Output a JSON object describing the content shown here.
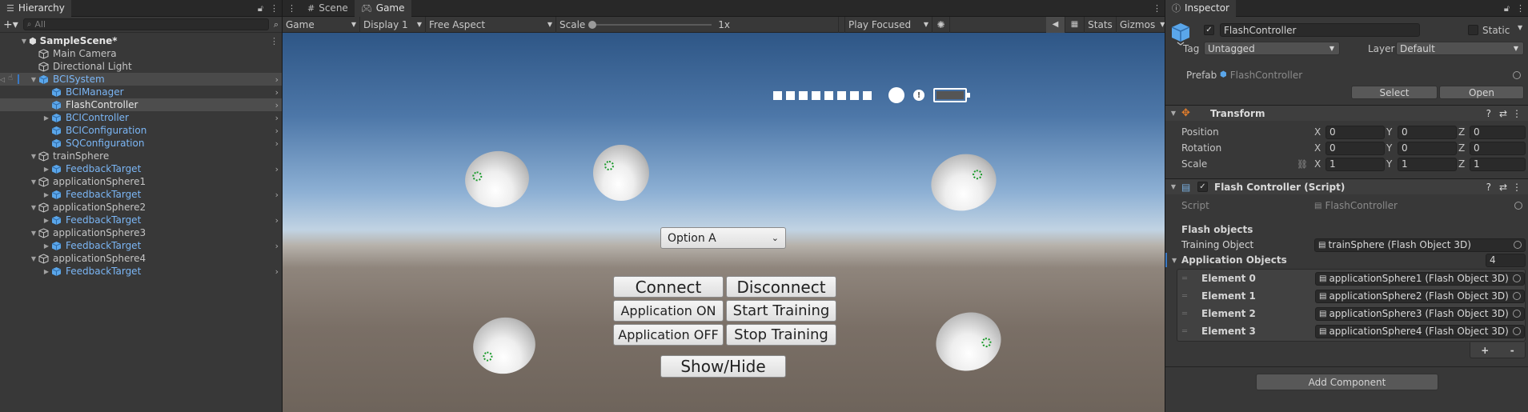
{
  "hierarchy": {
    "tab_label": "Hierarchy",
    "search_placeholder": "All",
    "scene_name": "SampleScene*",
    "items": [
      {
        "label": "Main Camera",
        "prefab": false
      },
      {
        "label": "Directional Light",
        "prefab": false
      },
      {
        "label": "BCISystem",
        "prefab": true
      },
      {
        "label": "BCIManager",
        "prefab": true
      },
      {
        "label": "FlashController",
        "prefab": true
      },
      {
        "label": "BCIController",
        "prefab": true
      },
      {
        "label": "BCIConfiguration",
        "prefab": true
      },
      {
        "label": "SQConfiguration",
        "prefab": true
      },
      {
        "label": "trainSphere",
        "prefab": false
      },
      {
        "label": "FeedbackTarget",
        "prefab": true
      },
      {
        "label": "applicationSphere1",
        "prefab": false
      },
      {
        "label": "FeedbackTarget",
        "prefab": true
      },
      {
        "label": "applicationSphere2",
        "prefab": false
      },
      {
        "label": "FeedbackTarget",
        "prefab": true
      },
      {
        "label": "applicationSphere3",
        "prefab": false
      },
      {
        "label": "FeedbackTarget",
        "prefab": true
      },
      {
        "label": "applicationSphere4",
        "prefab": false
      },
      {
        "label": "FeedbackTarget",
        "prefab": true
      }
    ]
  },
  "game": {
    "tabs": [
      {
        "label": "Scene"
      },
      {
        "label": "Game"
      }
    ],
    "toolbar": {
      "view_mode": "Game",
      "display": "Display 1",
      "aspect": "Free Aspect",
      "scale_label": "Scale",
      "scale_value": "1x",
      "play_mode": "Play Focused",
      "stats": "Stats",
      "gizmos": "Gizmos"
    },
    "ui": {
      "dropdown_value": "Option A",
      "connect": "Connect",
      "disconnect": "Disconnect",
      "app_on": "Application ON",
      "start_training": "Start Training",
      "app_off": "Application OFF",
      "stop_training": "Stop Training",
      "show_hide": "Show/Hide"
    }
  },
  "inspector": {
    "tab_label": "Inspector",
    "object_name": "FlashController",
    "static_label": "Static",
    "tag_label": "Tag",
    "tag_value": "Untagged",
    "layer_label": "Layer",
    "layer_value": "Default",
    "prefab_label": "Prefab",
    "prefab_value": "FlashController",
    "select_label": "Select",
    "open_label": "Open",
    "transform": {
      "title": "Transform",
      "position_label": "Position",
      "rotation_label": "Rotation",
      "scale_label": "Scale",
      "position": {
        "x": "0",
        "y": "0",
        "z": "0"
      },
      "rotation": {
        "x": "0",
        "y": "0",
        "z": "0"
      },
      "scale": {
        "x": "1",
        "y": "1",
        "z": "1"
      },
      "axis_x": "X",
      "axis_y": "Y",
      "axis_z": "Z"
    },
    "script_component": {
      "title": "Flash Controller (Script)",
      "script_label": "Script",
      "script_value": "FlashController",
      "section_label": "Flash objects",
      "training_label": "Training Object",
      "training_value": "trainSphere (Flash Object 3D)",
      "application_label": "Application Objects",
      "application_count": "4",
      "elements": [
        {
          "label": "Element 0",
          "value": "applicationSphere1 (Flash Object 3D)"
        },
        {
          "label": "Element 1",
          "value": "applicationSphere2 (Flash Object 3D)"
        },
        {
          "label": "Element 2",
          "value": "applicationSphere3 (Flash Object 3D)"
        },
        {
          "label": "Element 3",
          "value": "applicationSphere4 (Flash Object 3D)"
        }
      ],
      "add_symbol": "+",
      "remove_symbol": "-"
    },
    "add_component_label": "Add Component"
  }
}
